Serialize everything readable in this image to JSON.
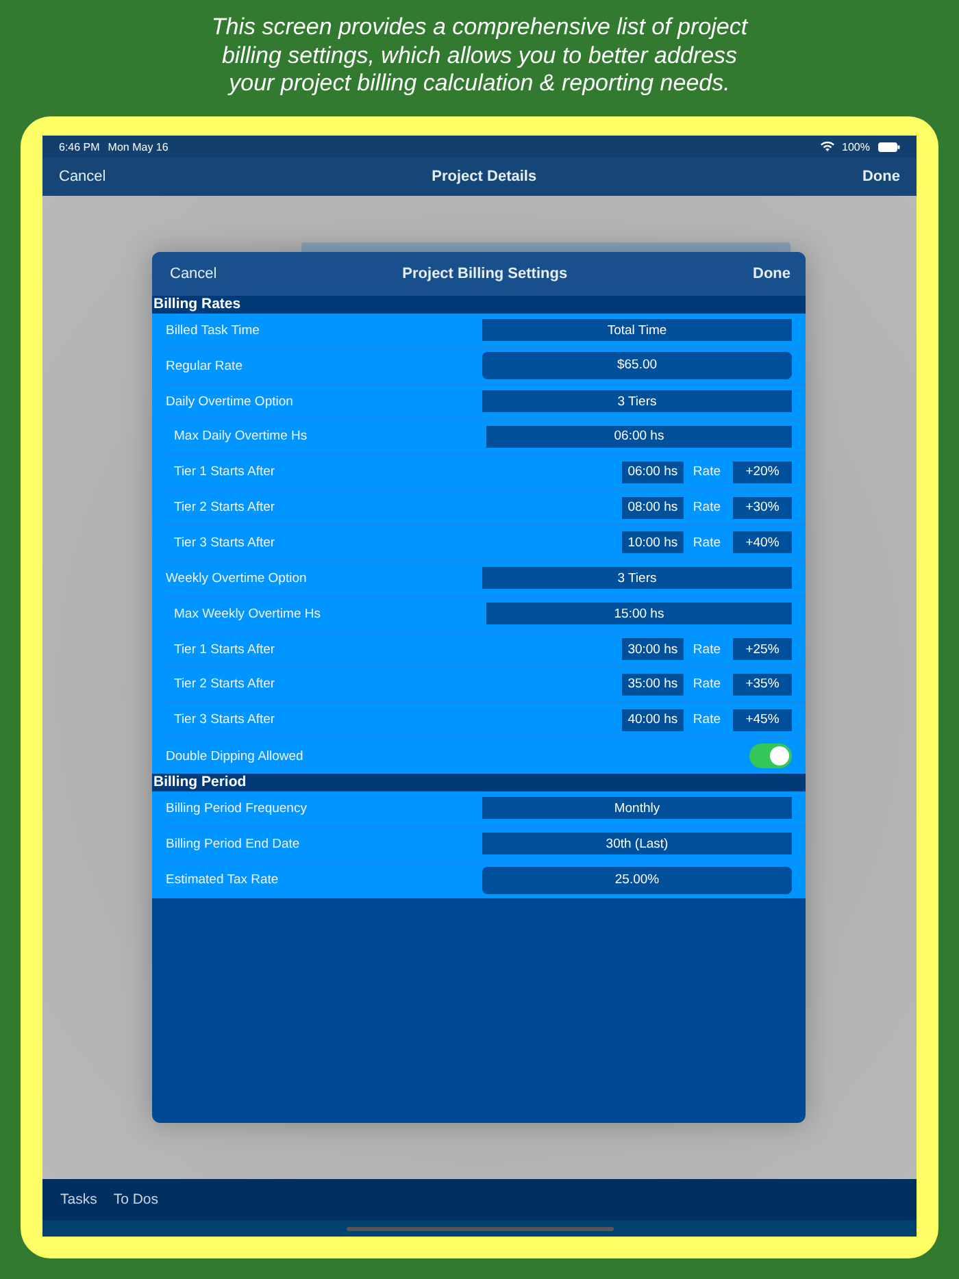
{
  "caption": "This screen provides a comprehensive list of project billing settings, which allows you to better address your project billing calculation & reporting needs.",
  "status_bar": {
    "time": "6:46 PM",
    "date": "Mon May 16",
    "battery": "100%"
  },
  "nav_bar": {
    "left": "Cancel",
    "title": "Project Details",
    "right": "Done"
  },
  "modal": {
    "left": "Cancel",
    "title": "Project Billing Settings",
    "right": "Done",
    "sections": [
      {
        "title": "Billing Rates",
        "rows": [
          {
            "kind": "select",
            "indented": false,
            "label": "Billed Task Time",
            "value": "Total Time"
          },
          {
            "kind": "field",
            "indented": false,
            "label": "Regular Rate",
            "value": "$65.00"
          },
          {
            "kind": "select",
            "indented": false,
            "label": "Daily Overtime Option",
            "value": "3 Tiers"
          },
          {
            "kind": "select",
            "indented": true,
            "label": "Max Daily Overtime Hs",
            "value": "06:00 hs"
          },
          {
            "kind": "tier",
            "indented": true,
            "label": "Tier 1 Starts After",
            "value": "06:00 hs",
            "rate_label": "Rate",
            "rate": "+20%"
          },
          {
            "kind": "tier",
            "indented": true,
            "label": "Tier 2 Starts After",
            "value": "08:00 hs",
            "rate_label": "Rate",
            "rate": "+30%"
          },
          {
            "kind": "tier",
            "indented": true,
            "label": "Tier 3 Starts After",
            "value": "10:00 hs",
            "rate_label": "Rate",
            "rate": "+40%"
          },
          {
            "kind": "select",
            "indented": false,
            "label": "Weekly Overtime Option",
            "value": "3 Tiers"
          },
          {
            "kind": "select",
            "indented": true,
            "label": "Max Weekly Overtime Hs",
            "value": "15:00 hs"
          },
          {
            "kind": "tier",
            "indented": true,
            "label": "Tier 1 Starts After",
            "value": "30:00 hs",
            "rate_label": "Rate",
            "rate": "+25%"
          },
          {
            "kind": "tier",
            "indented": true,
            "label": "Tier 2 Starts After",
            "value": "35:00 hs",
            "rate_label": "Rate",
            "rate": "+35%"
          },
          {
            "kind": "tier",
            "indented": true,
            "label": "Tier 3 Starts After",
            "value": "40:00 hs",
            "rate_label": "Rate",
            "rate": "+45%"
          },
          {
            "kind": "toggle",
            "indented": false,
            "label": "Double Dipping Allowed",
            "on": true
          }
        ]
      },
      {
        "title": "Billing Period",
        "rows": [
          {
            "kind": "select",
            "indented": false,
            "label": "Billing Period Frequency",
            "value": "Monthly"
          },
          {
            "kind": "select",
            "indented": false,
            "label": "Billing Period End Date",
            "value": "30th (Last)"
          },
          {
            "kind": "field",
            "indented": false,
            "label": "Estimated Tax Rate",
            "value": "25.00%"
          }
        ]
      }
    ]
  },
  "toolbar": [
    "Tasks",
    "To Dos"
  ]
}
